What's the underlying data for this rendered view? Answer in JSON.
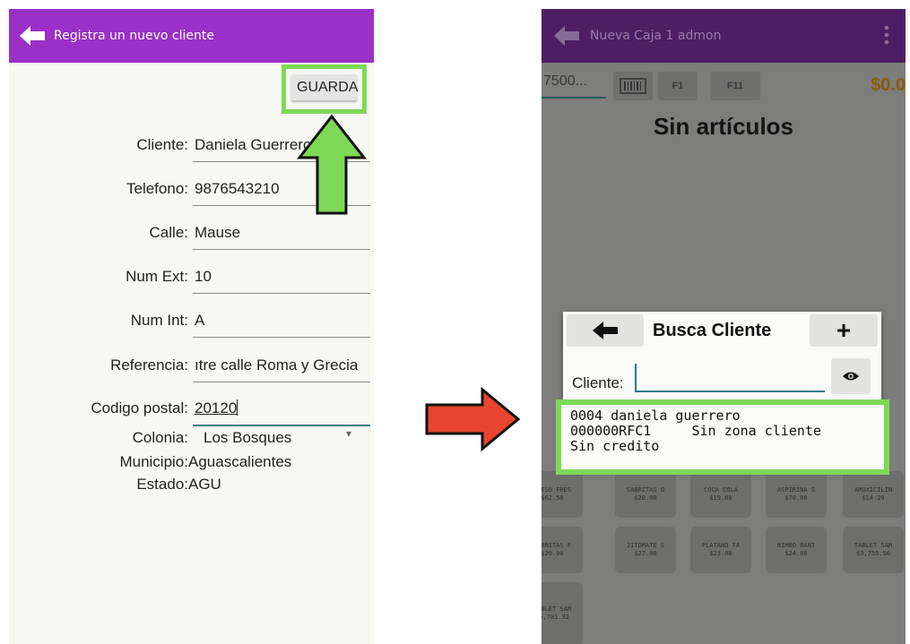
{
  "left": {
    "app_title": "Registra un nuevo cliente",
    "save_label": "GUARDA",
    "fields": [
      {
        "label": "Cliente:",
        "value": "Daniela Guerrero"
      },
      {
        "label": "Telefono:",
        "value": "9876543210"
      },
      {
        "label": "Calle:",
        "value": "Mause"
      },
      {
        "label": "Num Ext:",
        "value": "10"
      },
      {
        "label": "Num Int:",
        "value": "A"
      },
      {
        "label": "Referencia:",
        "value": "ıtre calle Roma y Grecia"
      },
      {
        "label": "Codigo postal:",
        "value": "20120"
      }
    ],
    "colonia_label": "Colonia:",
    "colonia_value": "Los Bosques",
    "municipio_label": "Municipio:",
    "municipio_value": "Aguascalientes",
    "estado_label": "Estado:",
    "estado_value": "AGU",
    "accent": "#9a30c8"
  },
  "right": {
    "app_title": "Nueva Caja 1 admon",
    "qty_value": "7500...",
    "f1_label": "F1",
    "f11_label": "F11",
    "total": "$0.0",
    "empty_title": "Sin artículos",
    "dialog": {
      "title": "Busca Cliente",
      "add_label": "+",
      "client_label": "Cliente:",
      "result_lines": [
        "0004 daniela guerrero",
        "000000RFC1     Sin zona cliente",
        "Sin credito"
      ]
    },
    "products": [
      {
        "name": "QUESO FRES",
        "price": "$62.50"
      },
      {
        "name": "SABRITAS O",
        "price": "$20.00"
      },
      {
        "name": "COCA COLA",
        "price": "$19.00"
      },
      {
        "name": "ASPIRINA S",
        "price": "$70.00"
      },
      {
        "name": "AMOXICILIN",
        "price": "$14.29"
      },
      {
        "name": "BARRITAS F",
        "price": "$20.00"
      },
      {
        "name": "JITOMATE S",
        "price": "$27.00"
      },
      {
        "name": "PLATANO TA",
        "price": "$23.00"
      },
      {
        "name": "BIMBO BANT",
        "price": "$24.00"
      },
      {
        "name": "TABLET SAM",
        "price": "$3,755.50"
      },
      {
        "name": "TABLET SAM",
        "price": "$5,781.32"
      }
    ],
    "header_color": "#4d1e64"
  },
  "highlight_color": "#7ed957",
  "arrow_color": "#e8452e"
}
